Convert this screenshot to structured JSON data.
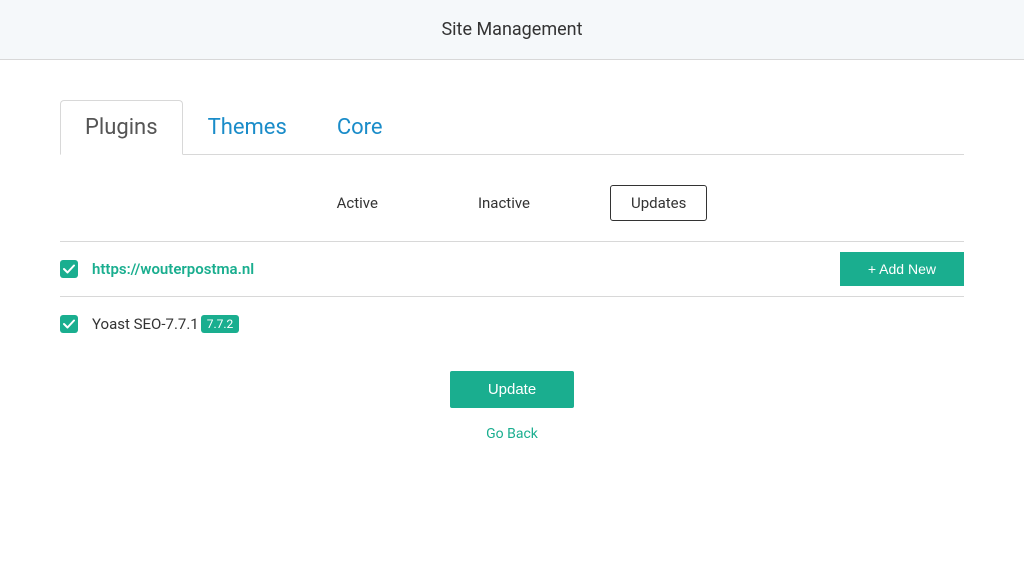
{
  "header": {
    "title": "Site Management"
  },
  "tabs": {
    "plugins": "Plugins",
    "themes": "Themes",
    "core": "Core"
  },
  "filters": {
    "active": "Active",
    "inactive": "Inactive",
    "updates": "Updates"
  },
  "site": {
    "url": "https://wouterpostma.nl",
    "add_new_label": "+ Add New"
  },
  "plugin": {
    "name": "Yoast SEO-7.7.1",
    "new_version": "7.7.2"
  },
  "actions": {
    "update": "Update",
    "go_back": "Go Back"
  }
}
